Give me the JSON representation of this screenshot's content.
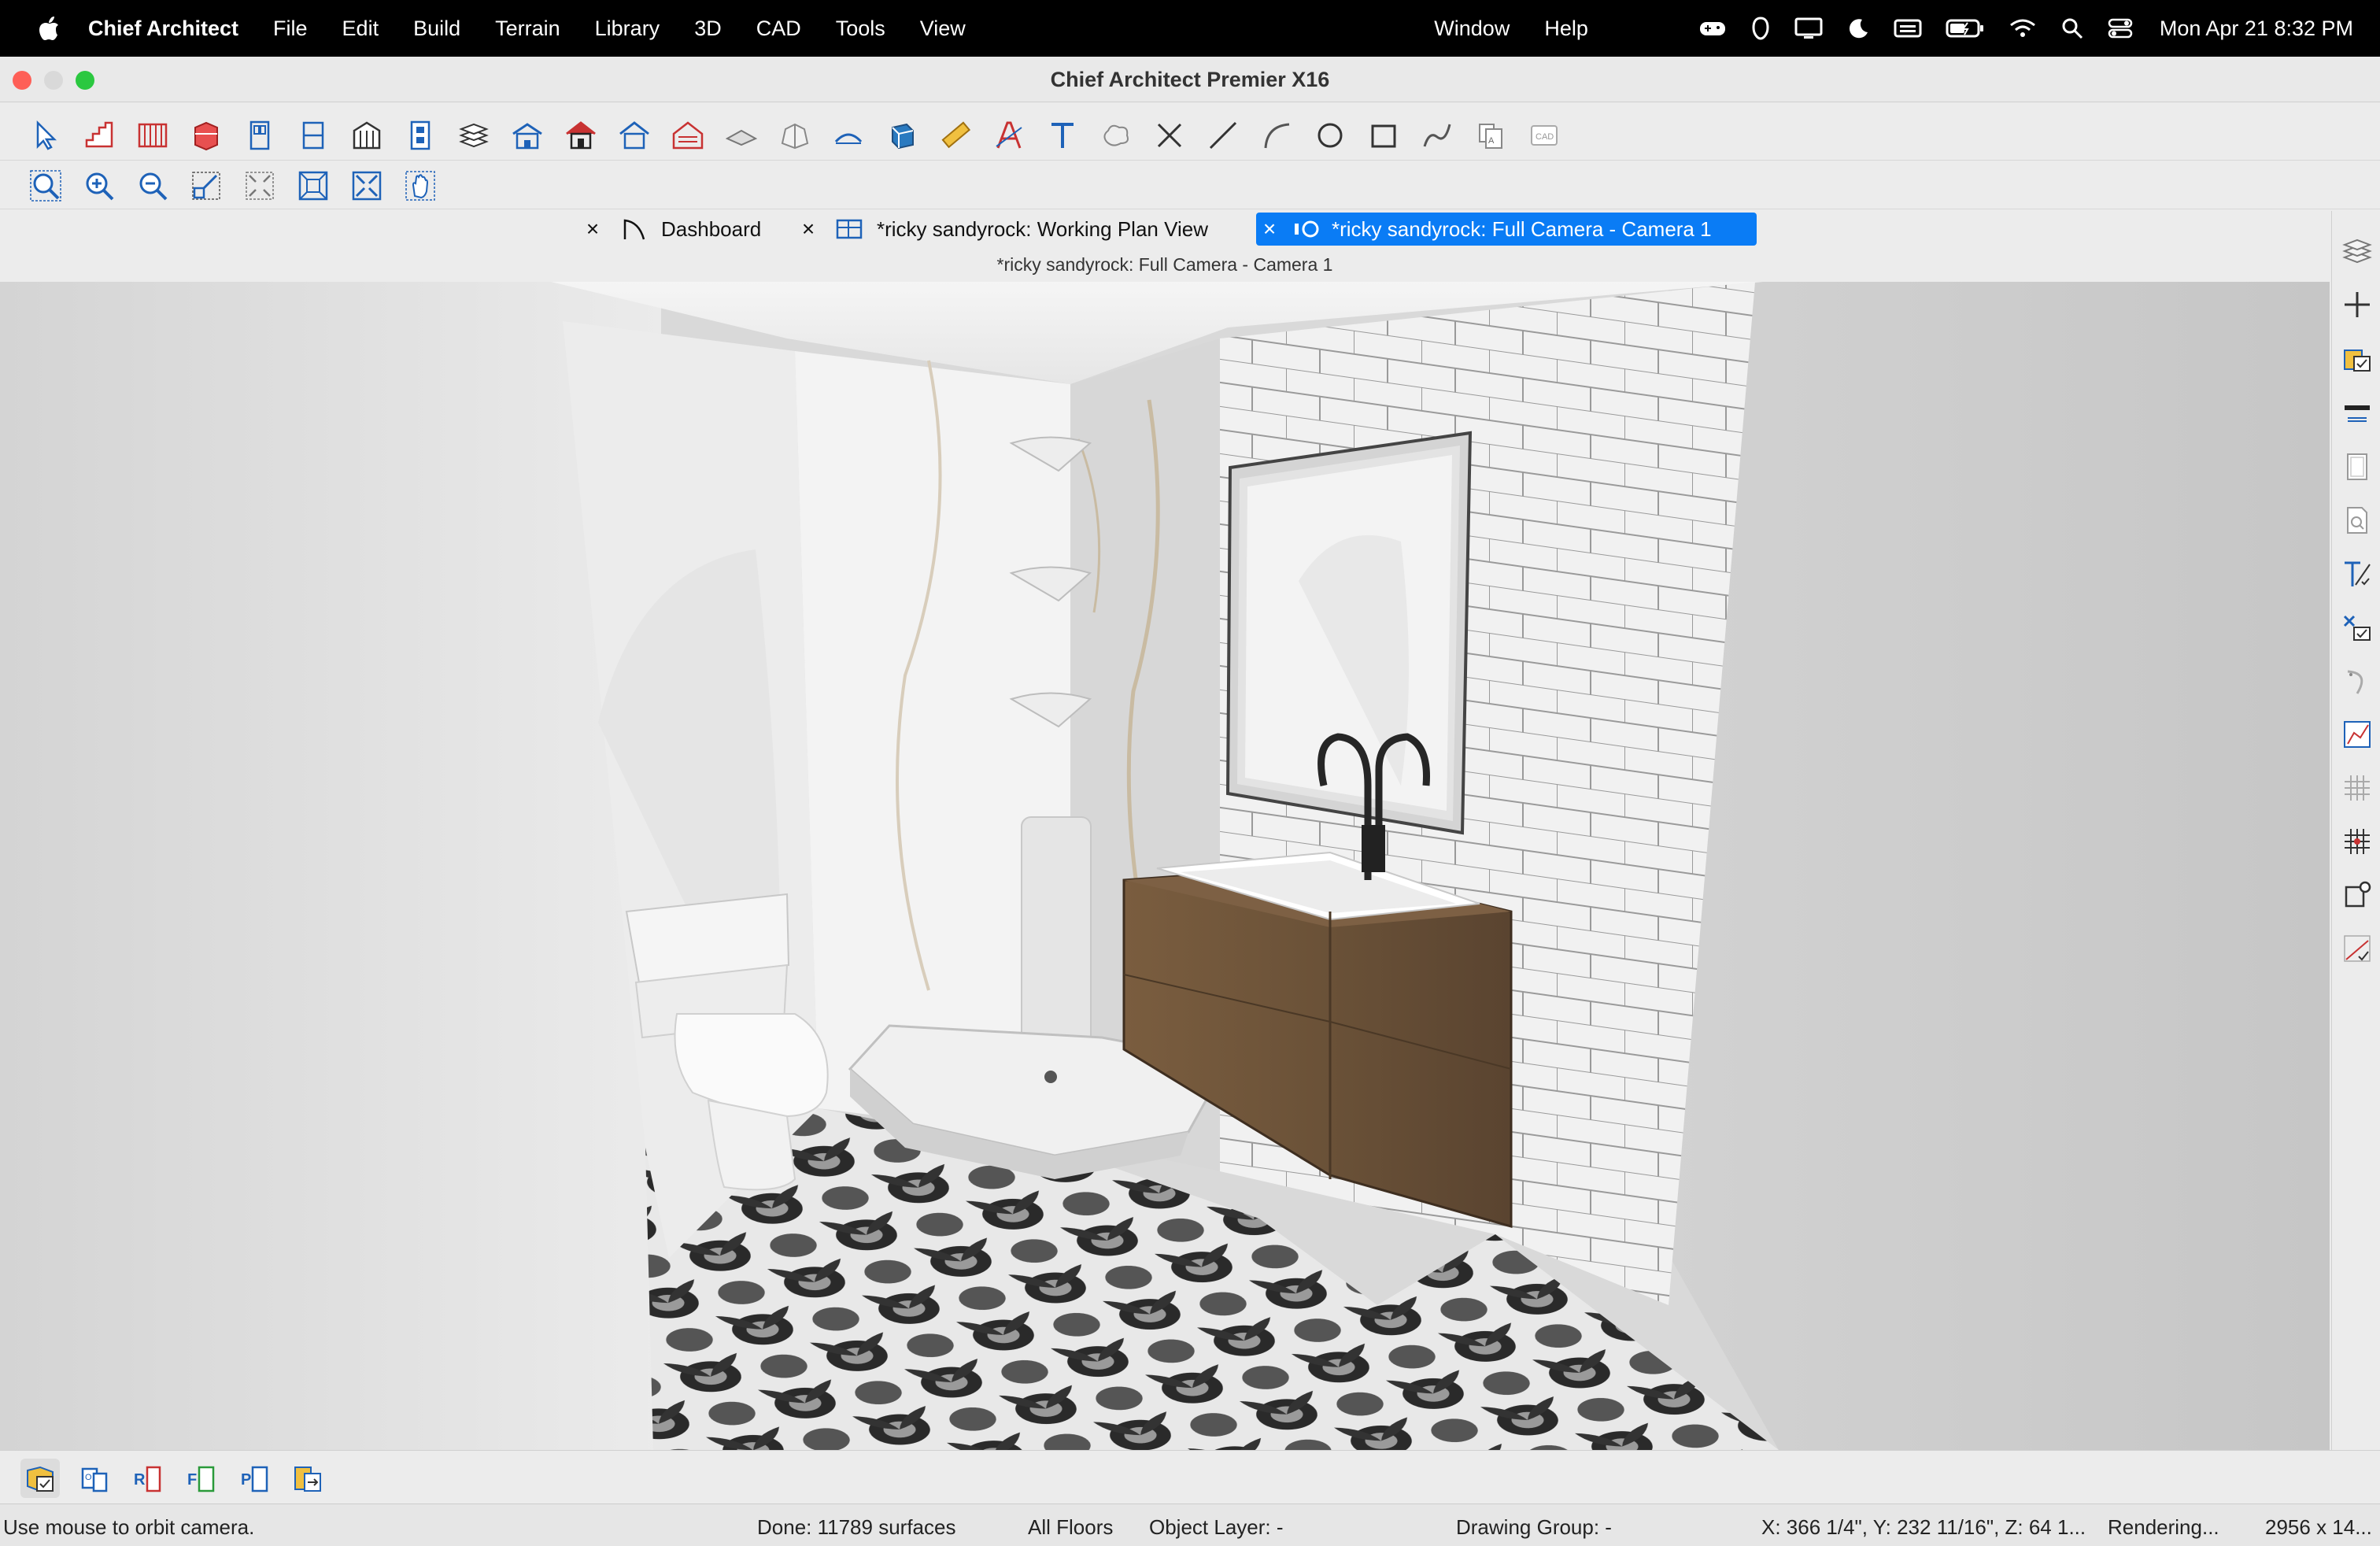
{
  "menubar": {
    "app_name": "Chief Architect",
    "menus": [
      "File",
      "Edit",
      "Build",
      "Terrain",
      "Library",
      "3D",
      "CAD",
      "Tools",
      "View"
    ],
    "right_menus": [
      "Window",
      "Help"
    ],
    "clock": "Mon Apr 21  8:32 PM",
    "status_icons": [
      "gamepad-icon",
      "guard-icon",
      "display-icon",
      "moon-icon",
      "keyboard-icon",
      "battery-icon",
      "wifi-icon",
      "search-icon",
      "control-center-icon"
    ]
  },
  "window": {
    "title": "Chief Architect Premier X16"
  },
  "toolbar_top": {
    "icons": [
      "select-objects-icon",
      "stairs-icon",
      "railing-icon",
      "cabinet-icon",
      "door-icon",
      "window-icon",
      "framing-icon",
      "electrical-icon",
      "floor-icon",
      "building-icon",
      "house-icon",
      "roof-icon",
      "barn-icon",
      "slab-icon",
      "terrain-icon",
      "dimension-icon",
      "material-icon",
      "ruler-icon",
      "text-style-icon",
      "text-icon",
      "cloud-icon",
      "cross-icon",
      "line-icon",
      "arc-icon",
      "circle-icon",
      "rectangle-icon",
      "spline-icon",
      "layer-display-icon",
      "cad-detail-icon"
    ]
  },
  "toolbar_second": {
    "icons": [
      "zoom-icon",
      "zoom-in-icon",
      "zoom-out-icon",
      "undo-zoom-icon",
      "fill-window-icon",
      "fill-window-building-icon",
      "full-screen-icon",
      "pan-icon"
    ]
  },
  "tabs": [
    {
      "label": "Dashboard",
      "icon": "dashboard-icon",
      "active": false
    },
    {
      "label": "*ricky sandyrock:  Working Plan View",
      "icon": "plan-view-icon",
      "active": false
    },
    {
      "label": "*ricky sandyrock: Full Camera - Camera 1",
      "icon": "camera-icon",
      "active": true
    }
  ],
  "view": {
    "title": "*ricky sandyrock: Full Camera - Camera 1"
  },
  "right_toolbar": {
    "icons": [
      "layers-icon",
      "add-icon",
      "edit-object-icon",
      "wall-icon",
      "page-icon",
      "preview-icon",
      "edit-line-icon",
      "edit-selection-icon",
      "curve-icon",
      "chart-icon",
      "grid-icon",
      "grid-snap-icon",
      "object-snap-icon",
      "angle-snap-icon"
    ]
  },
  "bottom_toolbar": {
    "icons": [
      "camera-edit-icon",
      "camera-orbit-icon",
      "camera-r-icon",
      "camera-f-icon",
      "camera-p-icon",
      "camera-export-icon"
    ]
  },
  "status": {
    "message": "Use mouse to orbit camera.",
    "done": "Done:  11789 surfaces",
    "floors": "All Floors",
    "object_layer": "Object Layer: -",
    "drawing_group": "Drawing Group: -",
    "coords": "X: 366 1/4\", Y: 232 11/16\", Z: 64 1...",
    "rendering": "Rendering...",
    "size": "2956 x 14..."
  },
  "colors": {
    "active_tab": "#0a7cf5",
    "menubar": "#000000",
    "vanity": "#6b5238",
    "close_red": "#fe5f57",
    "minimize_yellow": "#d9d9d9",
    "zoom_green": "#2bc840"
  }
}
